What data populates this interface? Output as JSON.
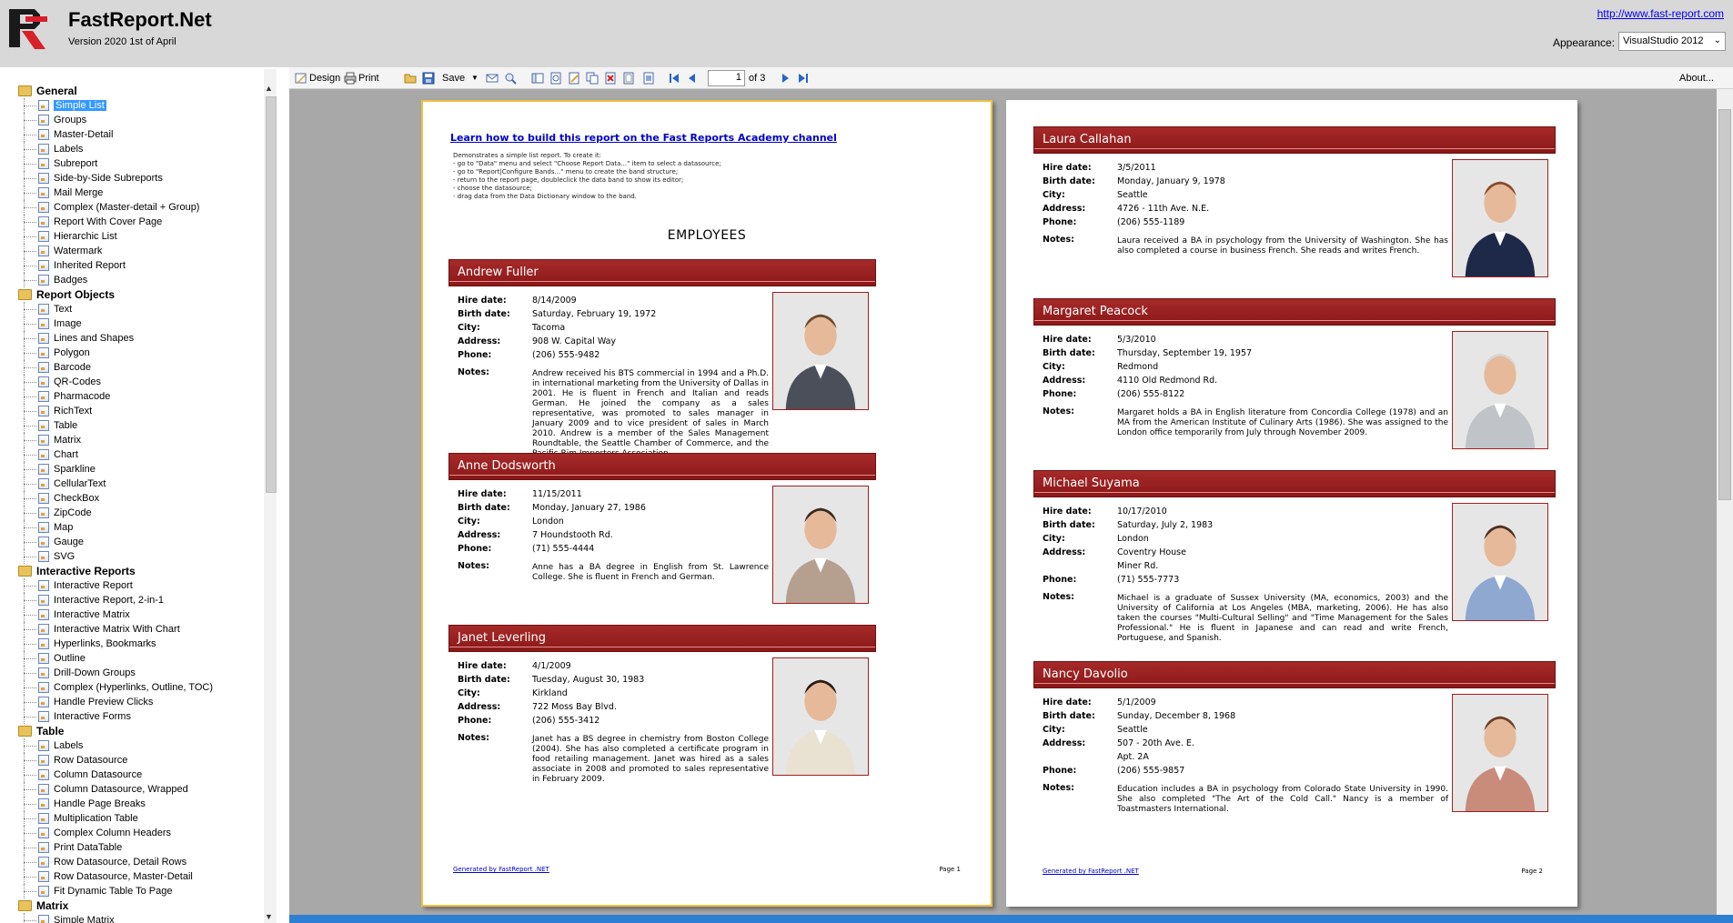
{
  "header": {
    "title": "FastReport.Net",
    "version": "Version 2020 1st of April",
    "link": "http://www.fast-report.com",
    "appearance_label": "Appearance:",
    "appearance_value": "VisualStudio 2012"
  },
  "sidebar": {
    "groups": [
      {
        "label": "General",
        "items": [
          "Simple List",
          "Groups",
          "Master-Detail",
          "Labels",
          "Subreport",
          "Side-by-Side Subreports",
          "Mail Merge",
          "Complex (Master-detail + Group)",
          "Report With Cover Page",
          "Hierarchic List",
          "Watermark",
          "Inherited Report",
          "Badges"
        ]
      },
      {
        "label": "Report Objects",
        "items": [
          "Text",
          "Image",
          "Lines and Shapes",
          "Polygon",
          "Barcode",
          "QR-Codes",
          "Pharmacode",
          "RichText",
          "Table",
          "Matrix",
          "Chart",
          "Sparkline",
          "CellularText",
          "CheckBox",
          "ZipCode",
          "Map",
          "Gauge",
          "SVG"
        ]
      },
      {
        "label": "Interactive Reports",
        "items": [
          "Interactive Report",
          "Interactive Report, 2-in-1",
          "Interactive Matrix",
          "Interactive Matrix With Chart",
          "Hyperlinks, Bookmarks",
          "Outline",
          "Drill-Down Groups",
          "Complex (Hyperlinks, Outline, TOC)",
          "Handle Preview Clicks",
          "Interactive Forms"
        ]
      },
      {
        "label": "Table",
        "items": [
          "Labels",
          "Row Datasource",
          "Column Datasource",
          "Column Datasource, Wrapped",
          "Handle Page Breaks",
          "Multiplication Table",
          "Complex Column Headers",
          "Print DataTable",
          "Row Datasource, Detail Rows",
          "Row Datasource, Master-Detail",
          "Fit Dynamic Table To Page"
        ]
      },
      {
        "label": "Matrix",
        "items": [
          "Simple Matrix"
        ]
      }
    ],
    "selected": "Simple List"
  },
  "toolbar": {
    "design": "Design",
    "print": "Print",
    "save": "Save",
    "page_current": "1",
    "page_total": "of 3",
    "about": "About..."
  },
  "page1": {
    "learn_link": "Learn how to build this report on the Fast Reports Academy channel",
    "demo_lines": [
      "Demonstrates a simple list report. To create it:",
      "- go to \"Data\" menu and select \"Choose Report Data...\" item to select a datasource;",
      "- go to \"Report|Configure Bands...\" menu to create the band structure;",
      "- return to the report page, doubleclick the data band to show its editor;",
      "- choose the datasource;",
      "- drag data from the Data Dictionary window to the band."
    ],
    "heading": "EMPLOYEES",
    "footer_gen": "Generated by FastReport .NET",
    "footer_page": "Page 1"
  },
  "page2": {
    "footer_gen": "Generated by FastReport .NET",
    "footer_page": "Page 2"
  },
  "labels": {
    "hire": "Hire date:",
    "birth": "Birth date:",
    "city": "City:",
    "address": "Address:",
    "phone": "Phone:",
    "notes": "Notes:"
  },
  "employees": [
    {
      "name": "Andrew Fuller",
      "hire": "8/14/2009",
      "birth": "Saturday, February 19, 1972",
      "city": "Tacoma",
      "address": "908 W. Capital Way",
      "phone": "(206) 555-9482",
      "notes": "Andrew received his BTS commercial in 1994 and a Ph.D. in international marketing from the University of Dallas in 2001. He is fluent in French and Italian and reads German. He joined the company as a sales representative, was promoted to sales manager in January 2009 and to vice president of sales in March 2010. Andrew is a member of the Sales Management Roundtable, the Seattle Chamber of Commerce, and the Pacific Rim Importers Association."
    },
    {
      "name": "Anne Dodsworth",
      "hire": "11/15/2011",
      "birth": "Monday, January 27, 1986",
      "city": "London",
      "address": "7 Houndstooth Rd.",
      "phone": "(71) 555-4444",
      "notes": "Anne has a BA degree in English from St. Lawrence College. She is fluent in French and German."
    },
    {
      "name": "Janet Leverling",
      "hire": "4/1/2009",
      "birth": "Tuesday, August 30, 1983",
      "city": "Kirkland",
      "address": "722 Moss Bay Blvd.",
      "phone": "(206) 555-3412",
      "notes": "Janet has a BS degree in chemistry from Boston College (2004). She has also completed a certificate program in food retailing management. Janet was hired as a sales associate in 2008 and promoted to sales representative in February 2009."
    },
    {
      "name": "Laura Callahan",
      "hire": "3/5/2011",
      "birth": "Monday, January 9, 1978",
      "city": "Seattle",
      "address": "4726 - 11th Ave. N.E.",
      "phone": "(206) 555-1189",
      "notes": "Laura received a BA in psychology from the University of Washington. She has also completed a course in business French. She reads and writes French."
    },
    {
      "name": "Margaret Peacock",
      "hire": "5/3/2010",
      "birth": "Thursday, September 19, 1957",
      "city": "Redmond",
      "address": "4110 Old Redmond Rd.",
      "phone": "(206) 555-8122",
      "notes": "Margaret holds a BA in English literature from Concordia College (1978) and an MA from the American Institute of Culinary Arts (1986). She was assigned to the London office temporarily from July through November 2009."
    },
    {
      "name": "Michael Suyama",
      "hire": "10/17/2010",
      "birth": "Saturday, July 2, 1983",
      "city": "London",
      "address": "Coventry House",
      "address2": "Miner Rd.",
      "phone": "(71) 555-7773",
      "notes": "Michael is a graduate of Sussex University (MA, economics, 2003) and the University of California at Los Angeles (MBA, marketing, 2006). He has also taken the courses \"Multi-Cultural Selling\" and \"Time Management for the Sales Professional.\" He is fluent in Japanese and can read and write French, Portuguese, and Spanish."
    },
    {
      "name": "Nancy Davolio",
      "hire": "5/1/2009",
      "birth": "Sunday, December 8, 1968",
      "city": "Seattle",
      "address": "507 - 20th Ave. E.",
      "address2": "Apt. 2A",
      "phone": "(206) 555-9857",
      "notes": "Education includes a BA in psychology from Colorado State University in 1990. She also completed \"The Art of the Cold Call.\" Nancy is a member of Toastmasters International."
    }
  ]
}
